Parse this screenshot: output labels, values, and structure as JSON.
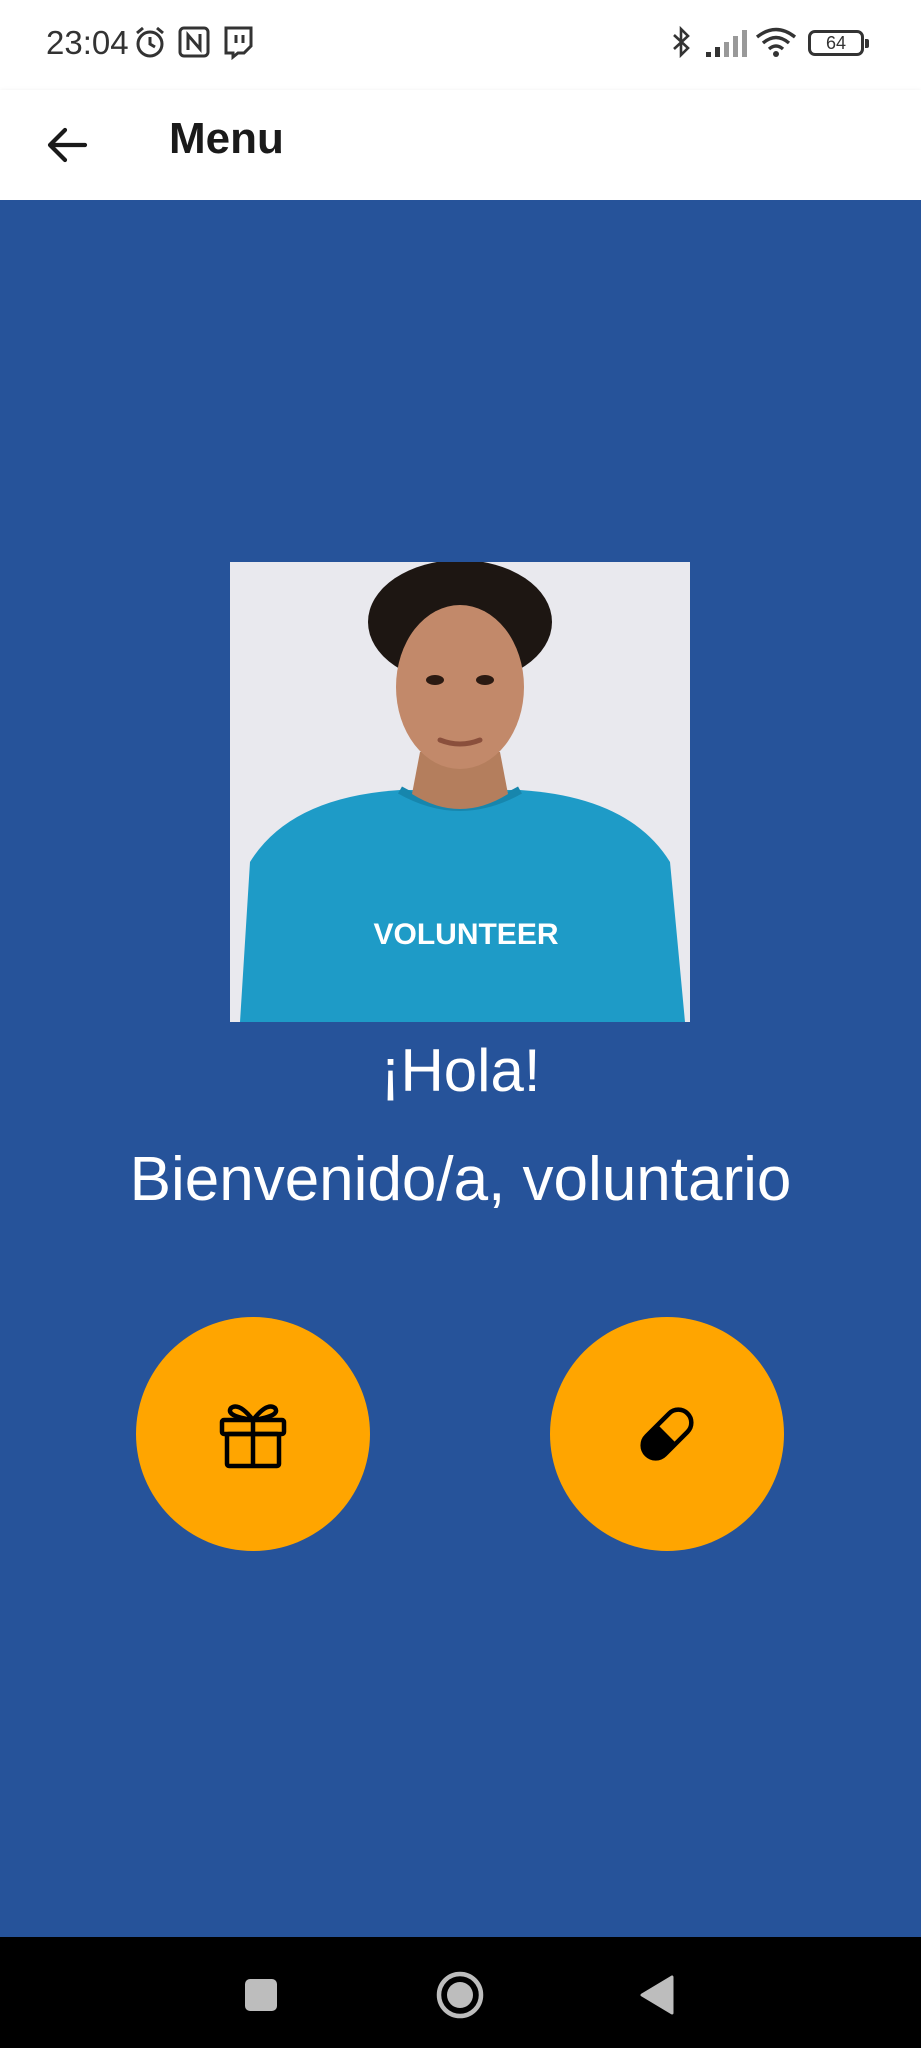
{
  "status_bar": {
    "time": "23:04",
    "battery": "64",
    "icons": [
      "alarm-icon",
      "nfc-icon",
      "twitch-icon",
      "bluetooth-icon",
      "signal-icon",
      "wifi-icon",
      "battery-icon"
    ]
  },
  "app_bar": {
    "title": "Menu",
    "back_icon": "arrow-left-icon"
  },
  "main": {
    "photo_text": "VOLUNTEER",
    "greeting": "¡Hola!",
    "welcome": "Bienvenido/a, voluntario",
    "buttons": [
      {
        "icon": "gift-icon"
      },
      {
        "icon": "pill-icon"
      }
    ]
  },
  "colors": {
    "background": "#26539a",
    "accent": "#ffa500",
    "appbar": "#ffffff",
    "navbar": "#000000"
  },
  "nav_bar": {
    "icons": [
      "recent-apps-icon",
      "home-icon",
      "back-triangle-icon"
    ]
  }
}
